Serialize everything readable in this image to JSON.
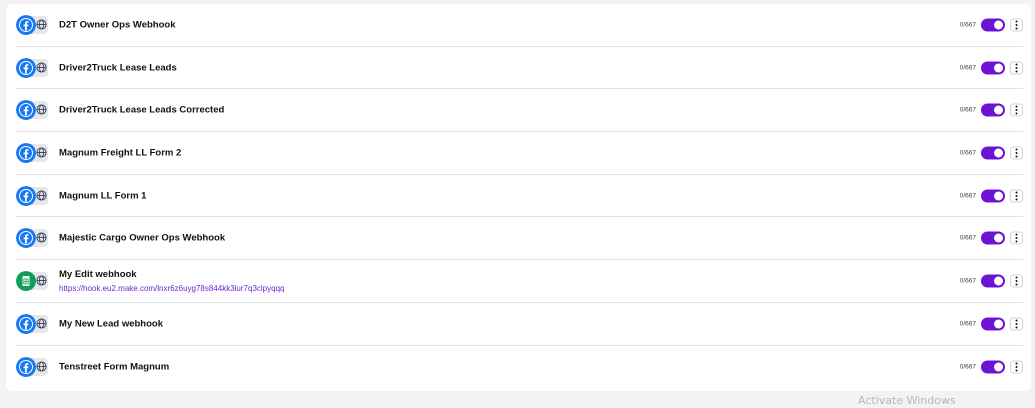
{
  "colors": {
    "accent": "#6d13d6",
    "facebook": "#1877f2",
    "sheets": "#0f9d58",
    "link": "#6d28d9"
  },
  "rows": [
    {
      "title": "D2T Owner Ops Webhook",
      "source_icon": "facebook-icon",
      "count": "0/667",
      "enabled": true
    },
    {
      "title": "Driver2Truck Lease Leads",
      "source_icon": "facebook-icon",
      "count": "0/667",
      "enabled": true
    },
    {
      "title": "Driver2Truck Lease Leads Corrected",
      "source_icon": "facebook-icon",
      "count": "0/667",
      "enabled": true
    },
    {
      "title": "Magnum Freight LL Form 2",
      "source_icon": "facebook-icon",
      "count": "0/667",
      "enabled": true
    },
    {
      "title": "Magnum LL Form 1",
      "source_icon": "facebook-icon",
      "count": "0/667",
      "enabled": true
    },
    {
      "title": "Majestic Cargo Owner Ops Webhook",
      "source_icon": "facebook-icon",
      "count": "0/667",
      "enabled": true
    },
    {
      "title": "My Edit webhook",
      "url": "https://hook.eu2.make.com/lnxr6z6uyg78s844kk3lur7q3clpyqqq",
      "source_icon": "google-sheets-icon",
      "count": "0/667",
      "enabled": true
    },
    {
      "title": "My New Lead webhook",
      "source_icon": "facebook-icon",
      "count": "0/667",
      "enabled": true
    },
    {
      "title": "Tenstreet Form Magnum",
      "source_icon": "facebook-icon",
      "count": "0/667",
      "enabled": true
    }
  ],
  "watermark": "Activate Windows"
}
